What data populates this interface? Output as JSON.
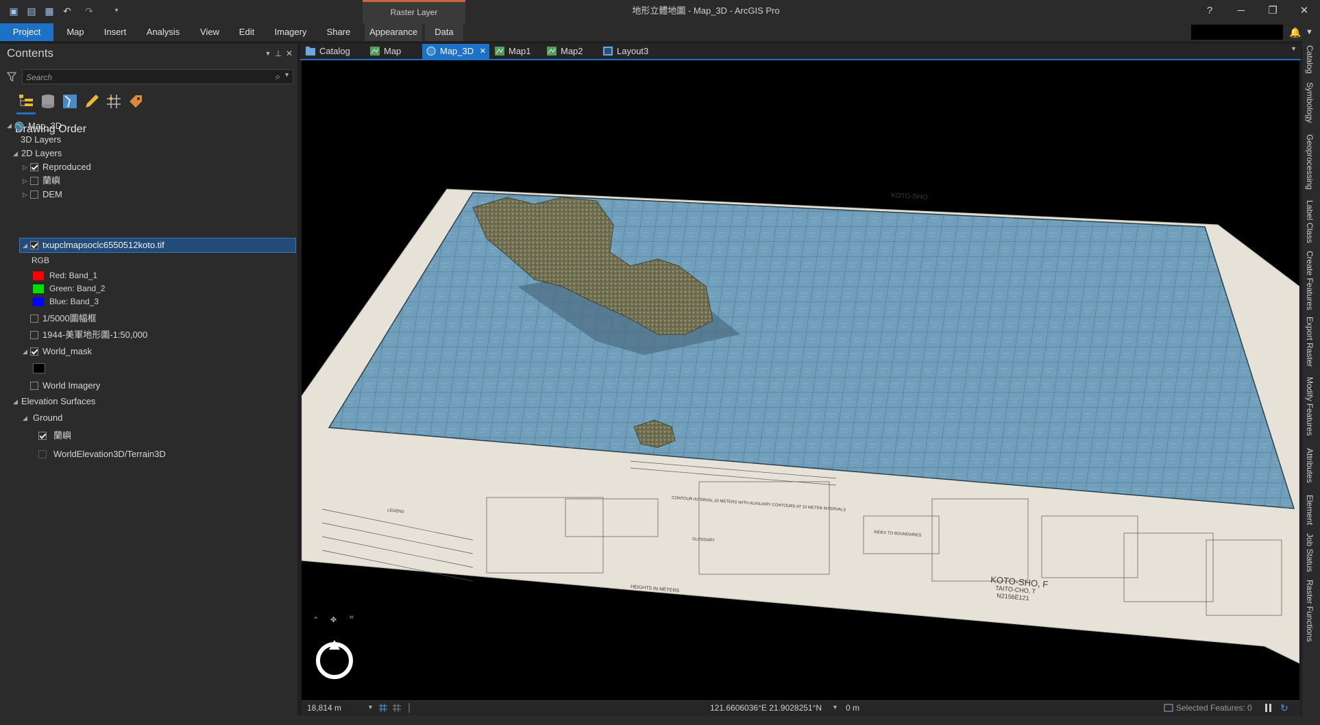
{
  "window": {
    "title": "地形立體地圖 - Map_3D - ArcGIS Pro",
    "contextual_tab": "Raster Layer",
    "help": "?",
    "minimize": "─",
    "restore": "❐",
    "close": "✕"
  },
  "ribbon": {
    "tabs": [
      "Project",
      "Map",
      "Insert",
      "Analysis",
      "View",
      "Edit",
      "Imagery",
      "Share",
      "Appearance",
      "Data"
    ],
    "active_tab": "Project"
  },
  "contents": {
    "title": "Contents",
    "search_placeholder": "Search",
    "section_title": "Drawing Order",
    "map_name": "Map_3D",
    "layers_3d": "3D Layers",
    "layers_2d": "2D Layers",
    "layers": [
      {
        "label": "Reproduced",
        "checked": true
      },
      {
        "label": "蘭嶼",
        "checked": false
      },
      {
        "label": "DEM",
        "checked": false
      },
      {
        "label": "txupclmapsoclc6550512koto.tif",
        "checked": true
      }
    ],
    "rgb_label": "RGB",
    "bands": [
      {
        "label": "Red:  Band_1",
        "color": "#ff0000"
      },
      {
        "label": "Green: Band_2",
        "color": "#00e000"
      },
      {
        "label": "Blue:  Band_3",
        "color": "#0000ff"
      }
    ],
    "more_layers": [
      {
        "label": "1/5000圖幅框",
        "checked": false
      },
      {
        "label": "1944-美軍地形圖-1:50,000",
        "checked": false
      },
      {
        "label": "World_mask",
        "checked": true
      }
    ],
    "world_imagery": "World Imagery",
    "elevation_surfaces": "Elevation Surfaces",
    "ground": "Ground",
    "ground_sources": [
      {
        "label": "蘭嶼",
        "checked": true
      },
      {
        "label": "WorldElevation3D/Terrain3D",
        "checked": false
      }
    ]
  },
  "view_tabs": [
    {
      "label": "Catalog",
      "icon": "catalog-icon"
    },
    {
      "label": "Map",
      "icon": "map-icon"
    },
    {
      "label": "Map_3D",
      "icon": "globe-icon"
    },
    {
      "label": "Map1",
      "icon": "map-icon"
    },
    {
      "label": "Map2",
      "icon": "map-icon"
    },
    {
      "label": "Layout3",
      "icon": "layout-icon"
    }
  ],
  "active_view": "Map_3D",
  "right_dock": [
    "Catalog",
    "Symbology",
    "Geoprocessing",
    "Label Class",
    "Create Features",
    "Export Raster",
    "Modify Features",
    "Attributes",
    "Element",
    "Job Status",
    "Raster Functions"
  ],
  "map_sheet": {
    "top_title": "KOTO-SHO",
    "corner_title": "KOTO-SHO, F",
    "corner_sub": "TAITO-CHO, T",
    "corner_code": "N2156E121",
    "heights_note": "HEIGHTS IN METERS",
    "contour_note": "CONTOUR INTERVAL 20 METERS WITH AUXILIARY CONTOURS AT 10 METER INTERVALS",
    "glossary": "GLOSSARY",
    "index_label": "INDEX TO BOUNDARIES",
    "legend_label": "LEGEND",
    "colors": {
      "sea": "#6f9fbb",
      "paper": "#e6e2d7",
      "land": "#6f7258"
    }
  },
  "status": {
    "scale": "18,814 m",
    "coordinates": "121.6606036°E 21.9028251°N",
    "elevation": "0 m",
    "selected_features": "Selected Features: 0"
  }
}
